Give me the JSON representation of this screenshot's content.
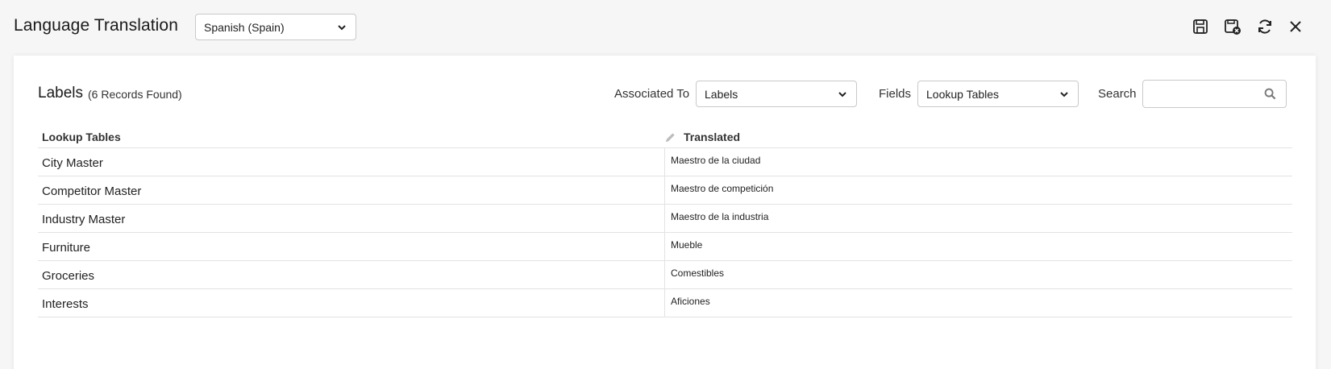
{
  "header": {
    "title": "Language Translation",
    "language_selected": "Spanish (Spain)"
  },
  "toolbar": {
    "save_icon": "save-icon",
    "save_close_icon": "save-and-close-icon",
    "refresh_icon": "refresh-icon",
    "close_icon": "close-icon"
  },
  "section": {
    "title": "Labels",
    "record_count": "(6 Records Found)"
  },
  "filters": {
    "associated_to_label": "Associated To",
    "associated_to_value": "Labels",
    "fields_label": "Fields",
    "fields_value": "Lookup Tables",
    "search_label": "Search",
    "search_value": ""
  },
  "grid": {
    "columns": [
      "Lookup Tables",
      "Translated"
    ],
    "rows": [
      {
        "original": "City Master",
        "translated": "Maestro de la ciudad"
      },
      {
        "original": "Competitor Master",
        "translated": "Maestro de competición"
      },
      {
        "original": "Industry Master",
        "translated": "Maestro de la industria"
      },
      {
        "original": "Furniture",
        "translated": "Mueble"
      },
      {
        "original": "Groceries",
        "translated": "Comestibles"
      },
      {
        "original": "Interests",
        "translated": "Aficiones"
      }
    ]
  }
}
